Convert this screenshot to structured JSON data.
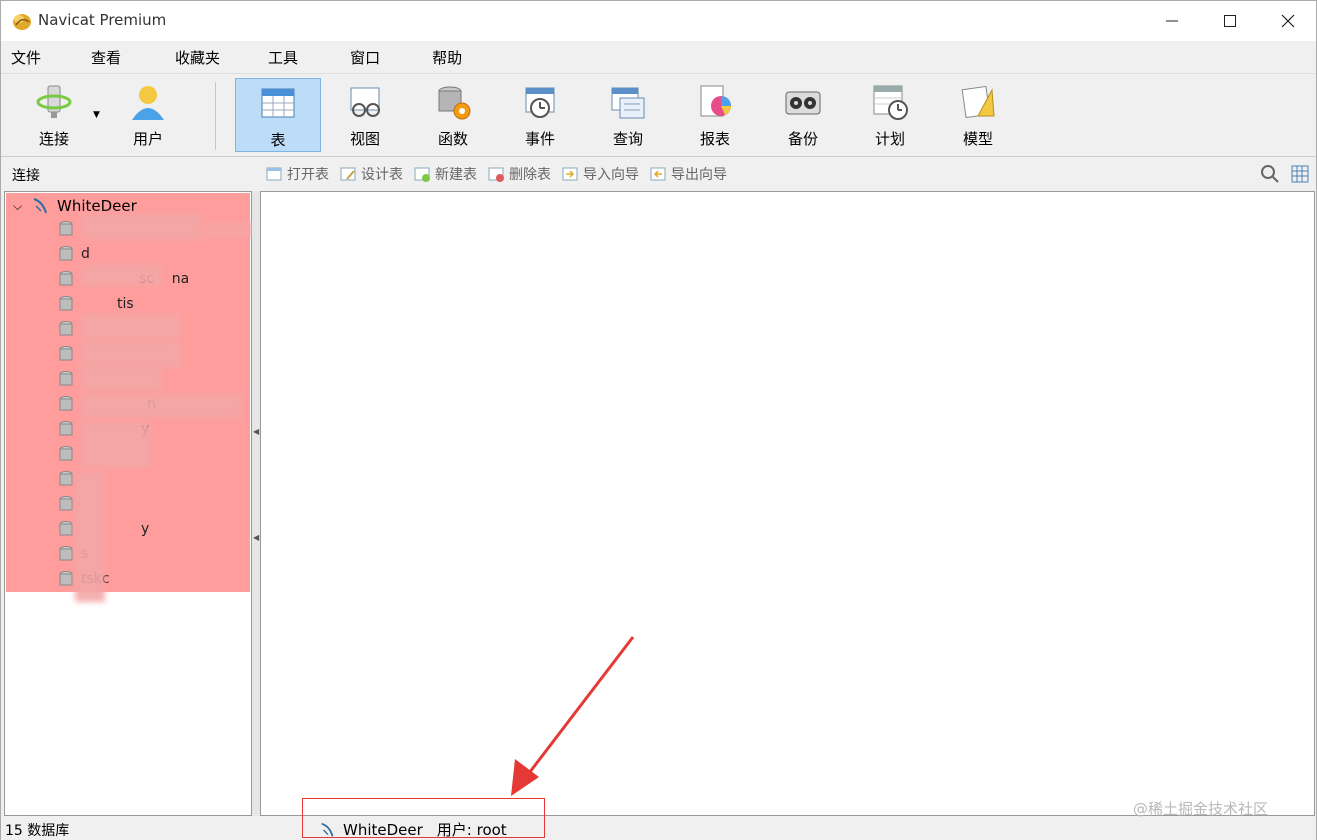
{
  "window": {
    "title": "Navicat Premium"
  },
  "menu": [
    "文件",
    "查看",
    "收藏夹",
    "工具",
    "窗口",
    "帮助"
  ],
  "toolbar": {
    "connect": "连接",
    "user": "用户",
    "items": [
      "表",
      "视图",
      "函数",
      "事件",
      "查询",
      "报表",
      "备份",
      "计划",
      "模型"
    ],
    "active": "表"
  },
  "objbar": {
    "title": "连接",
    "actions": [
      "打开表",
      "设计表",
      "新建表",
      "删除表",
      "导入向导",
      "导出向导"
    ]
  },
  "tree": {
    "root": "WhiteDeer",
    "databases": [
      "",
      "d",
      "sc    na",
      "tis",
      "",
      "",
      "",
      "n",
      "y",
      "",
      "",
      "",
      "y",
      "s",
      "tskc"
    ]
  },
  "status": {
    "count": "15 数据库",
    "connection": "WhiteDeer",
    "user": "用户: root"
  },
  "watermark": "@稀土掘金技术社区"
}
